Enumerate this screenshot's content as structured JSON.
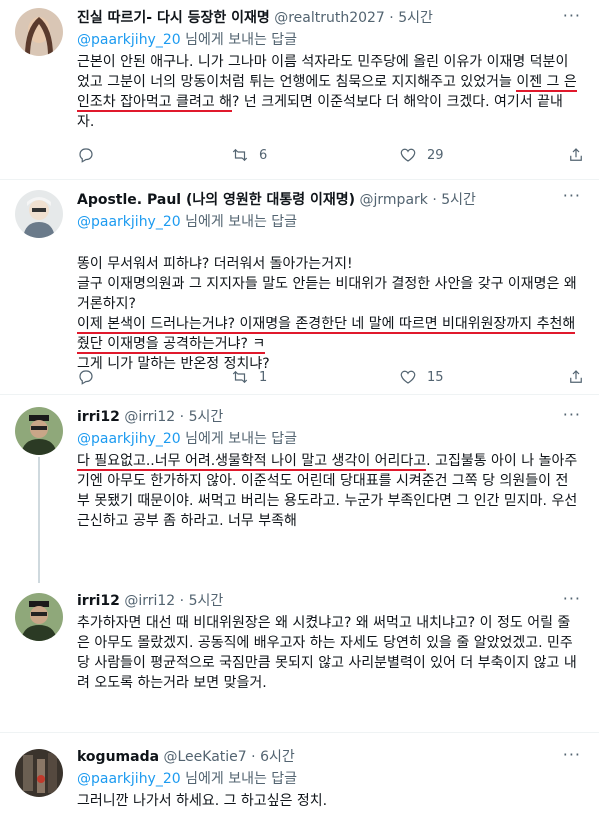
{
  "tweets": [
    {
      "name": "진실 따르기- 다시 등장한 이재명",
      "handle": "@realtruth2027",
      "dot": "·",
      "time": "5시간",
      "reply_mention": "@paarkjihy_20",
      "reply_suffix": " 님에게 보내는 답글",
      "segments": [
        {
          "t": "근본이 안된 애구나. 니가 그나마 이름 석자라도 민주당에 올린 이유가 이재명 덕분이었고 그분이 너의 망동이처럼 튀는 언행에도 침묵으로 지지해주고 있었거늘 ",
          "h": false
        },
        {
          "t": "이젠 그 은인조차 잡아먹고 클려고 해",
          "h": true
        },
        {
          "t": "? 넌 크게되면 이준석보다 더 해악이 크겠다. 여기서 끝내자.",
          "h": false
        }
      ],
      "replies": "",
      "retweets": "6",
      "likes": "29",
      "avatar_color": "#6b4a3c"
    },
    {
      "name": "Apostle. Paul (나의 영원한 대통령 이재명)",
      "handle": "@jrmpark",
      "dot": "·",
      "time": "5시간",
      "reply_mention": "@paarkjihy_20",
      "reply_suffix": " 님에게 보내는 답글",
      "segments": [
        {
          "t": "똥이 무서워서 피하냐? 더러워서 돌아가는거지!\n글구 이재명의원과 그 지지자들 말도 안듣는 비대위가 결정한 사안을 갖구 이재명은 왜 거론하지?\n",
          "h": false
        },
        {
          "t": "이제 본색이 드러나는거냐? 이재명을 존경한단 네 말에 따르면 비대위원장까지 추천해줬단 이재명을 공격하는거냐? ㅋ",
          "h": true
        },
        {
          "t": "\n그게 니가 말하는 반온정 정치냐?",
          "h": false
        }
      ],
      "replies": "",
      "retweets": "1",
      "likes": "15",
      "avatar_color": "#9aa3a8"
    },
    {
      "name": "irri12",
      "handle": "@irri12",
      "dot": "·",
      "time": "5시간",
      "reply_mention": "@paarkjihy_20",
      "reply_suffix": " 님에게 보내는 답글",
      "segments": [
        {
          "t": "다 필요없고..너무 어려.생물학적 나이 말고 생각이 어리다고",
          "h": true
        },
        {
          "t": ". 고집불통 아이 나 놀아주기엔 아무도 한가하지 않아. 이준석도 어린데 당대표를 시켜준건 그쪽 당 의원들이 전부 못됐기 때문이야. 써먹고 버리는 용도라고. 누군가 부족인다면 그 인간 믿지마. 우선 근신하고 공부 좀 하라고. 너무 부족해",
          "h": false
        }
      ],
      "replies": "",
      "retweets": "",
      "likes": "",
      "avatar_color": "#3d4f2f"
    },
    {
      "name": "irri12",
      "handle": "@irri12",
      "dot": "·",
      "time": "5시간",
      "reply_mention": "",
      "reply_suffix": "",
      "segments": [
        {
          "t": "추가하자면 대선 때 비대위원장은 왜 시켰냐고? 왜 써먹고 내치냐고? 이 정도 어릴 줄은 아무도 몰랐겠지. 공동직에 배우고자 하는 자세도 당연히 있을 줄 알았었겠고. 민주당 사람들이 평균적으로 국짐만큼 못되지 않고 사리분별력이 있어 더 부축이지 않고 내려 오도록 하는거라 보면 맞을거.",
          "h": false
        }
      ],
      "replies": "",
      "retweets": "",
      "likes": "",
      "avatar_color": "#3d4f2f"
    },
    {
      "name": "kogumada",
      "handle": "@LeeKatie7",
      "dot": "·",
      "time": "6시간",
      "reply_mention": "@paarkjihy_20",
      "reply_suffix": " 님에게 보내는 답글",
      "segments": [
        {
          "t": "그러니깐 나가서 하세요. 그 하고싶은 정치.",
          "h": false
        }
      ],
      "replies": "",
      "retweets": "",
      "likes": "",
      "avatar_color": "#4a4038"
    }
  ]
}
